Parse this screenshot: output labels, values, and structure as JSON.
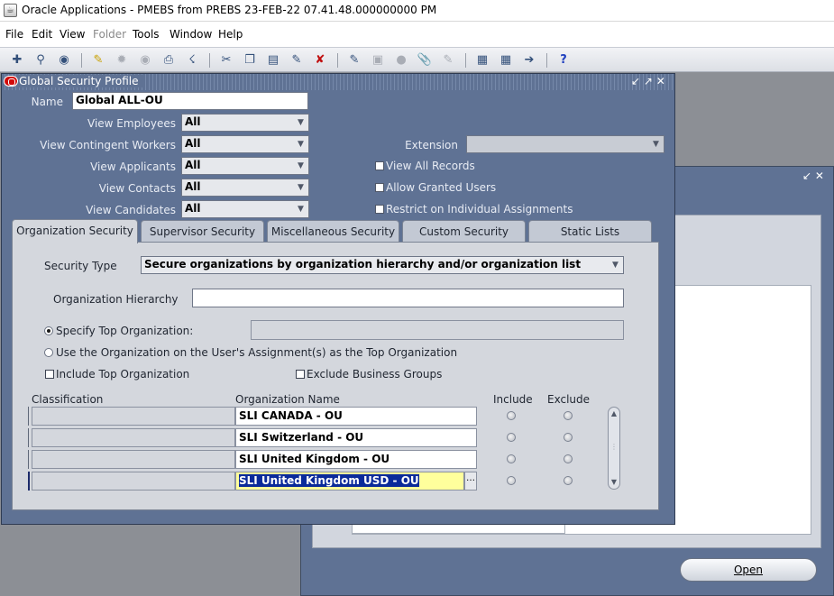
{
  "window_title": "Oracle Applications - PMEBS from PREBS 23-FEB-22 07.41.48.000000000 PM",
  "menu": [
    {
      "label": "File",
      "enabled": true
    },
    {
      "label": "Edit",
      "enabled": true
    },
    {
      "label": "View",
      "enabled": true
    },
    {
      "label": "Folder",
      "enabled": false
    },
    {
      "label": "Tools",
      "enabled": true
    },
    {
      "label": "Window",
      "enabled": true
    },
    {
      "label": "Help",
      "enabled": true
    }
  ],
  "toolbar_icons": [
    "new-record-icon",
    "find-icon",
    "navigator-icon",
    "save-icon",
    "next-step-icon",
    "switch-responsibility-icon",
    "print-icon",
    "close-form-icon",
    "cut-icon",
    "copy-icon",
    "paste-icon",
    "clear-record-icon",
    "delete-record-icon",
    "edit-field-icon",
    "zoom-icon",
    "translations-icon",
    "attachments-icon",
    "folder-tools-icon",
    "calendar-icon",
    "window-icon",
    "help-icon"
  ],
  "form": {
    "title": "Global Security Profile",
    "name_label": "Name",
    "name_value": "Global ALL-OU",
    "fields": [
      {
        "label": "View Employees",
        "value": "All"
      },
      {
        "label": "View Contingent Workers",
        "value": "All"
      },
      {
        "label": "View Applicants",
        "value": "All"
      },
      {
        "label": "View Contacts",
        "value": "All"
      },
      {
        "label": "View Candidates",
        "value": "All"
      }
    ],
    "extension_label": "Extension",
    "extension_value": "",
    "checkboxes": [
      {
        "label": "View All Records",
        "checked": false
      },
      {
        "label": "Allow Granted Users",
        "checked": false
      },
      {
        "label": "Restrict on Individual Assignments",
        "checked": false
      }
    ],
    "tabs": [
      {
        "label": "Organization Security",
        "active": true
      },
      {
        "label": "Supervisor Security",
        "active": false
      },
      {
        "label": "Miscellaneous Security",
        "active": false
      },
      {
        "label": "Custom Security",
        "active": false
      },
      {
        "label": "Static Lists",
        "active": false
      }
    ],
    "org_security": {
      "security_type_label": "Security Type",
      "security_type_value": "Secure organizations by organization hierarchy and/or organization list",
      "org_hierarchy_label": "Organization Hierarchy",
      "org_hierarchy_value": "",
      "radio_specify_top": "Specify Top Organization:",
      "radio_use_assignment": "Use the Organization on the User's Assignment(s) as the Top Organization",
      "include_top_org": "Include Top Organization",
      "exclude_business_groups": "Exclude Business Groups",
      "columns": {
        "classification": "Classification",
        "org_name": "Organization Name",
        "include": "Include",
        "exclude": "Exclude"
      },
      "rows": [
        {
          "classification": "",
          "org_name": "SLI CANADA - OU"
        },
        {
          "classification": "",
          "org_name": "SLI Switzerland - OU"
        },
        {
          "classification": "",
          "org_name": "SLI United Kingdom - OU"
        },
        {
          "classification": "",
          "org_name": "SLI United Kingdom USD - OU"
        }
      ]
    }
  },
  "background_window": {
    "open_button": "Open"
  },
  "colors": {
    "window_frame": "#5f7294",
    "panel": "#d4d7dd",
    "selection": "#0a2a9a",
    "current_field": "#ffff9c",
    "close_icon": "#d10a0a"
  }
}
